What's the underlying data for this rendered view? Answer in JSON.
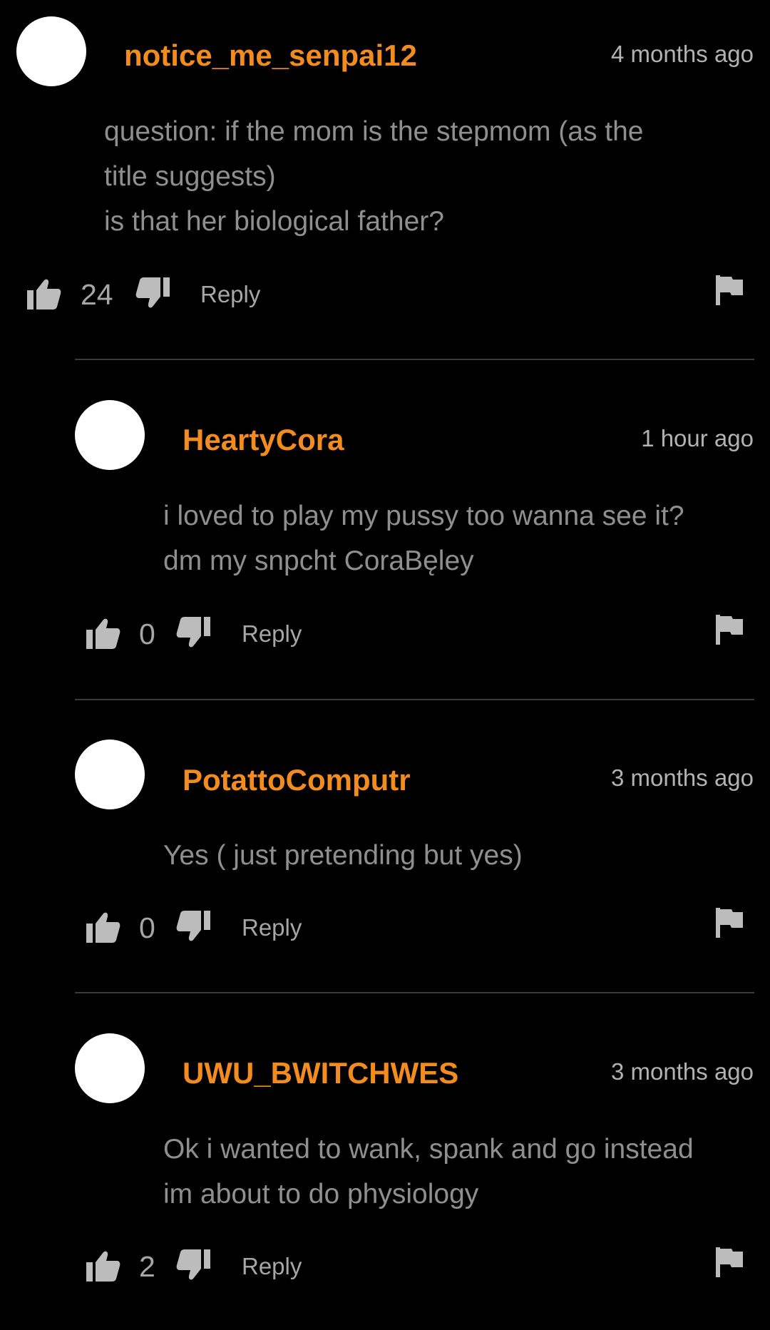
{
  "comments": [
    {
      "username": "notice_me_senpai12",
      "time": "4 months ago",
      "lines": [
        "question: if the mom is the stepmom (as the",
        "title suggests)",
        "is that her biological father?"
      ],
      "likes": "24",
      "reply_label": "Reply"
    },
    {
      "username": "HeartyCora",
      "time": "1 hour ago",
      "lines": [
        "i loved to play my pussy too wanna see it?",
        "dm my snpcht CoraBęley"
      ],
      "likes": "0",
      "reply_label": "Reply"
    },
    {
      "username": "PotattoComputr",
      "time": "3 months ago",
      "lines": [
        "Yes ( just pretending but yes)"
      ],
      "likes": "0",
      "reply_label": "Reply"
    },
    {
      "username": "UWU_BWITCHWES",
      "time": "3 months ago",
      "lines": [
        "Ok i wanted to wank, spank and go instead",
        "im about to do physiology"
      ],
      "likes": "2",
      "reply_label": "Reply"
    }
  ],
  "colors": {
    "background": "#000000",
    "username": "#f28c1f",
    "text": "#8f8f8f",
    "divider": "#3a3a3a"
  },
  "icons": [
    "like-icon",
    "dislike-icon",
    "flag-icon"
  ]
}
